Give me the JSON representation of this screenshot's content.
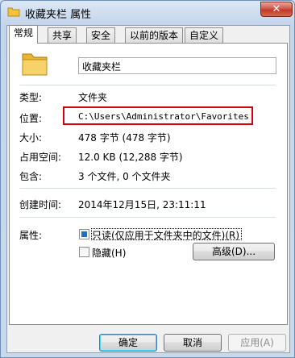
{
  "window": {
    "title": "收藏夹栏 属性",
    "close_label": "✕"
  },
  "tabs": [
    "常规",
    "共享",
    "安全",
    "以前的版本",
    "自定义"
  ],
  "general": {
    "folder_name": "收藏夹栏",
    "type_label": "类型:",
    "type_value": "文件夹",
    "location_label": "位置:",
    "location_value": "C:\\Users\\Administrator\\Favorites",
    "size_label": "大小:",
    "size_value": "478 字节 (478 字节)",
    "size_on_disk_label": "占用空间:",
    "size_on_disk_value": "12.0 KB (12,288 字节)",
    "contains_label": "包含:",
    "contains_value": "3 个文件, 0 个文件夹",
    "created_label": "创建时间:",
    "created_value": "2014年12月15日, 23:11:11",
    "attributes_label": "属性:",
    "readonly_label": "只读(仅应用于文件夹中的文件)(R)",
    "readonly_checked": true,
    "hidden_label": "隐藏(H)",
    "hidden_checked": false,
    "advanced_label": "高级(D)..."
  },
  "footer": {
    "ok_label": "确定",
    "cancel_label": "取消",
    "apply_label": "应用(A)"
  },
  "colors": {
    "highlight_box": "#d9000d",
    "folder": "#f3c43a",
    "checkbox_fill": "#1f6fc8"
  },
  "icons": {
    "title": "folder-icon",
    "large": "folder-icon"
  }
}
